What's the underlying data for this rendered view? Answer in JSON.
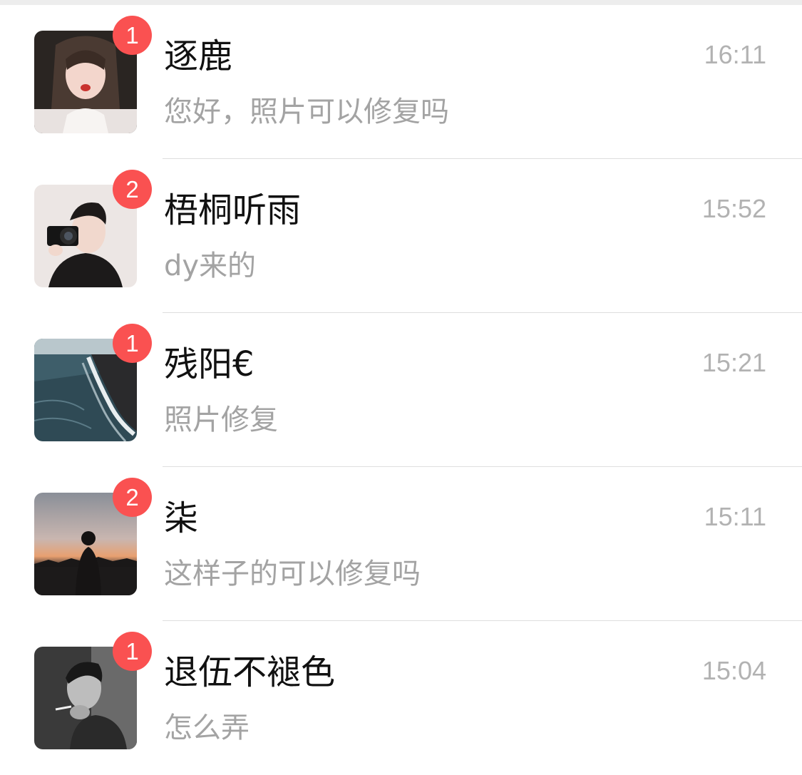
{
  "conversations": [
    {
      "name": "逐鹿",
      "preview": "您好，照片可以修复吗",
      "time": "16:11",
      "unread": "1",
      "avatar": "avatar-photo-girl"
    },
    {
      "name": "梧桐听雨",
      "preview": "dy来的",
      "time": "15:52",
      "unread": "2",
      "avatar": "avatar-photo-camera-man"
    },
    {
      "name": "残阳€",
      "preview": "照片修复",
      "time": "15:21",
      "unread": "1",
      "avatar": "avatar-photo-beach"
    },
    {
      "name": "柒",
      "preview": "这样子的可以修复吗",
      "time": "15:11",
      "unread": "2",
      "avatar": "avatar-photo-sunset-silhouette"
    },
    {
      "name": "退伍不褪色",
      "preview": "怎么弄",
      "time": "15:04",
      "unread": "1",
      "avatar": "avatar-photo-smoking-man"
    }
  ],
  "colors": {
    "badge": "#fa5151",
    "name_text": "#111111",
    "preview_text": "#a3a3a3",
    "time_text": "#b2b2b2",
    "divider": "#dedede"
  }
}
